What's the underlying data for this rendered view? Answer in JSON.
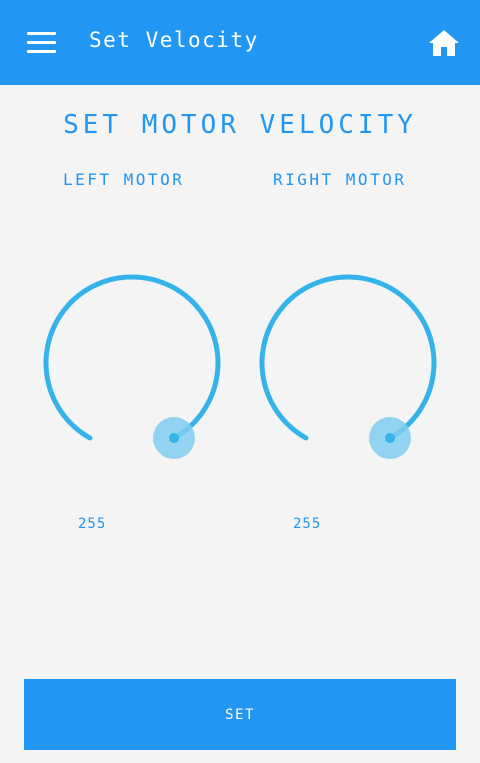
{
  "appbar": {
    "title": "Set Velocity",
    "menu_icon": "hamburger-menu-icon",
    "home_icon": "home-icon"
  },
  "page": {
    "heading": "SET MOTOR VELOCITY"
  },
  "motors": [
    {
      "label": "LEFT MOTOR",
      "value": "255"
    },
    {
      "label": "RIGHT MOTOR",
      "value": "255"
    }
  ],
  "actions": {
    "set_label": "SET"
  },
  "colors": {
    "primary": "#2196f3",
    "knob_arc": "#34b3ea",
    "knob_thumb": "#7fcdee",
    "background": "#f4f4f4"
  }
}
